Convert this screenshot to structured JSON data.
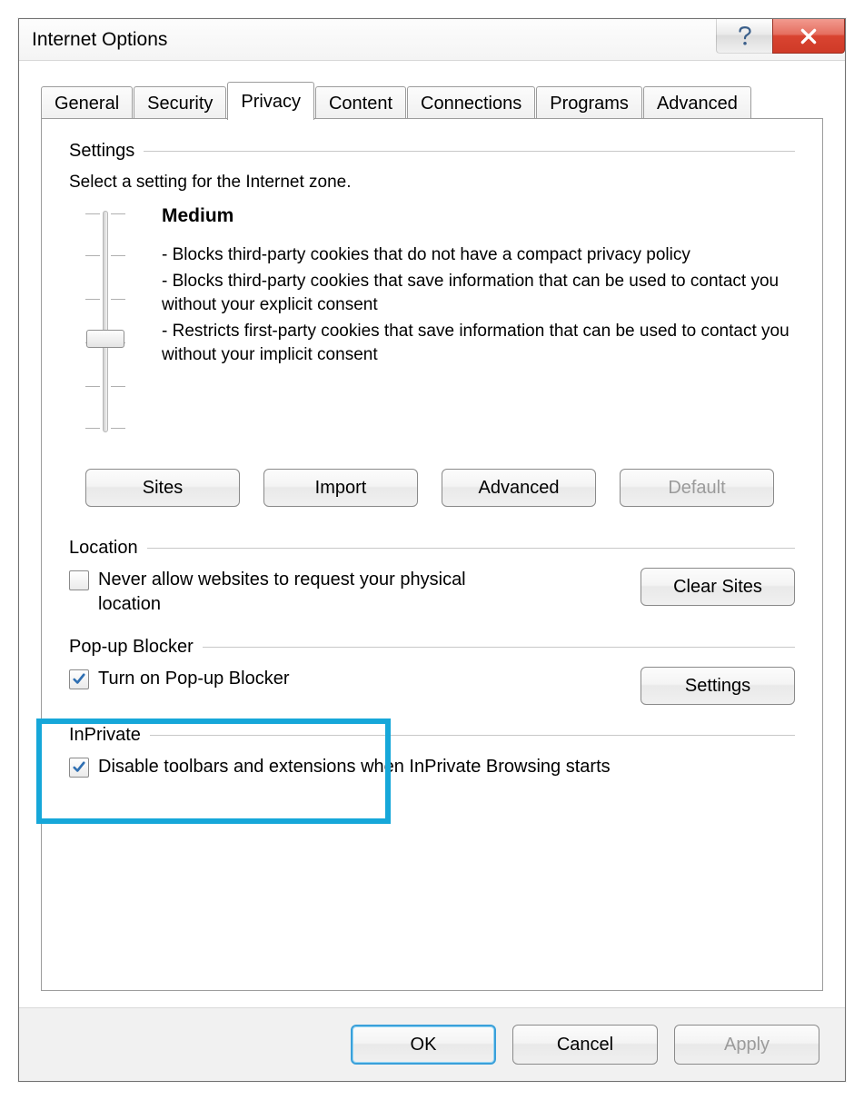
{
  "window": {
    "title": "Internet Options"
  },
  "tabs": {
    "t0": "General",
    "t1": "Security",
    "t2": "Privacy",
    "t3": "Content",
    "t4": "Connections",
    "t5": "Programs",
    "t6": "Advanced"
  },
  "settings": {
    "heading": "Settings",
    "intro": "Select a setting for the Internet zone.",
    "level": "Medium",
    "bullets": {
      "b1": "- Blocks third-party cookies that do not have a compact privacy policy",
      "b2": "- Blocks third-party cookies that save information that can be used to contact you without your explicit consent",
      "b3": "- Restricts first-party cookies that save information that can be used to contact you without your implicit consent"
    },
    "buttons": {
      "sites": "Sites",
      "import": "Import",
      "advanced": "Advanced",
      "default": "Default"
    }
  },
  "location": {
    "heading": "Location",
    "chk_label": "Never allow websites to request your physical location",
    "clear_btn": "Clear Sites"
  },
  "popup": {
    "heading": "Pop-up Blocker",
    "chk_label": "Turn on Pop-up Blocker",
    "settings_btn": "Settings"
  },
  "inprivate": {
    "heading": "InPrivate",
    "chk_label": "Disable toolbars and extensions when InPrivate Browsing starts"
  },
  "actions": {
    "ok": "OK",
    "cancel": "Cancel",
    "apply": "Apply"
  }
}
